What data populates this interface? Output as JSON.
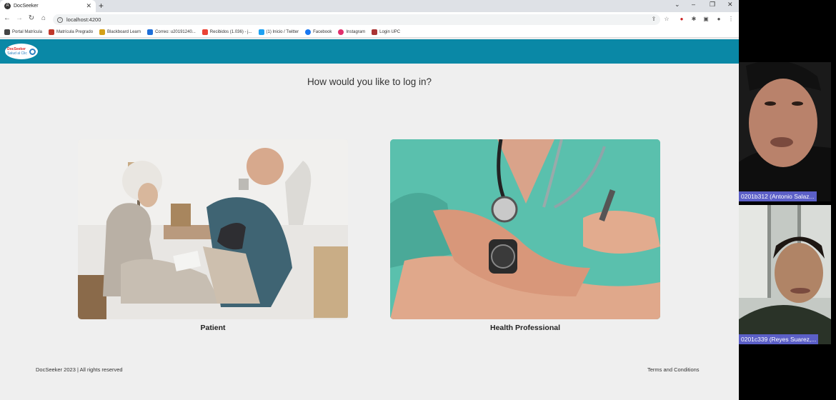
{
  "browser": {
    "tab_title": "DocSeeker",
    "tab_favicon": "A",
    "url": "localhost:4200",
    "bookmarks": [
      {
        "label": "Portal Matrícula",
        "color": "#444"
      },
      {
        "label": "Matrícula Pregrado",
        "color": "#c0392b"
      },
      {
        "label": "Blackboard Learn",
        "color": "#d4a017"
      },
      {
        "label": "Correo: u20191240...",
        "color": "#1e6fd9"
      },
      {
        "label": "Recibidos (1.036) - j...",
        "color": "#ea4335"
      },
      {
        "label": "(1) Inicio / Twitter",
        "color": "#1da1f2"
      },
      {
        "label": "Facebook",
        "color": "#1877f2"
      },
      {
        "label": "Instagram",
        "color": "#e1306c"
      },
      {
        "label": "Login UPC",
        "color": "#a33"
      }
    ]
  },
  "site": {
    "header_color": "#0a88a6",
    "logo_text": "DocSeeker",
    "logo_tagline": "Salud al Clic",
    "question": "How would you like to log in?",
    "options": [
      {
        "label": "Patient"
      },
      {
        "label": "Health Professional"
      }
    ],
    "footer_left": "DocSeeker 2023 | All rights reserved",
    "footer_right": "Terms and Conditions"
  },
  "participants": [
    {
      "name": "0201b312 (Antonio Salaz..."
    },
    {
      "name": "0201c339 (Reyes Suarez,..."
    }
  ]
}
